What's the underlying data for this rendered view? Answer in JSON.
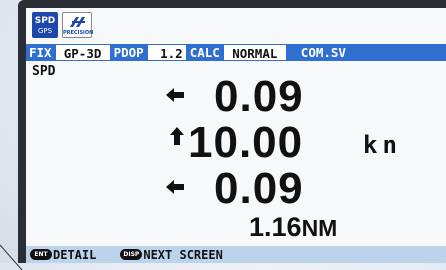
{
  "icons": {
    "spd": {
      "line1": "SPD",
      "line2": "GPS"
    },
    "precision": {
      "text": "PRECISION"
    }
  },
  "status_bar": {
    "fix_label": "FIX",
    "fix_value": "GP-3D",
    "pdop_label": "PDOP",
    "pdop_value": "1.2",
    "calc_label": "CALC",
    "calc_value": "NORMAL",
    "com": "COM.SV"
  },
  "main": {
    "mode_label": "SPD",
    "speed_1": "0.09",
    "speed_2": "10.00",
    "speed_3": "0.09",
    "unit": "kn",
    "distance_value": "1.16",
    "distance_unit": "NM"
  },
  "bottom_bar": {
    "ent_key": "ENT",
    "detail_label": "DETAIL",
    "disp_key": "DISP",
    "next_label": "NEXT SCREEN"
  },
  "colors": {
    "status_bar": "#2f6fd0",
    "bottom_bar": "#bcd3ec",
    "screen_bg": "#f7f8fa"
  }
}
